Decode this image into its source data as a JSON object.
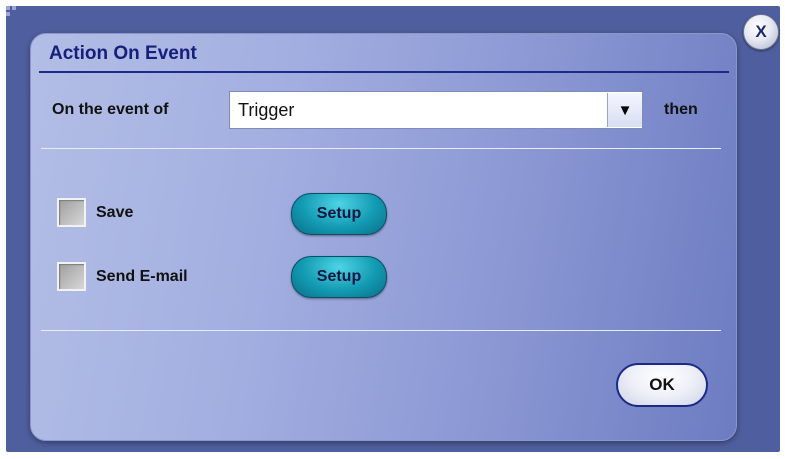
{
  "dialog": {
    "title": "Action On Event",
    "close_label": "X"
  },
  "event": {
    "label": "On the event of",
    "selected": "Trigger",
    "arrow": "▼",
    "suffix": "then"
  },
  "actions": [
    {
      "label": "Save",
      "checked": false,
      "setup_label": "Setup"
    },
    {
      "label": "Send E-mail",
      "checked": false,
      "setup_label": "Setup"
    }
  ],
  "footer": {
    "ok_label": "OK"
  },
  "icons": {
    "close": "close-icon",
    "dropdown": "chevron-down-icon",
    "grip": "window-grip-icon"
  },
  "colors": {
    "frame": "#4f5e9e",
    "title": "#16207a",
    "setup_button": "#139bb3",
    "ok_border": "#1a2a88"
  }
}
